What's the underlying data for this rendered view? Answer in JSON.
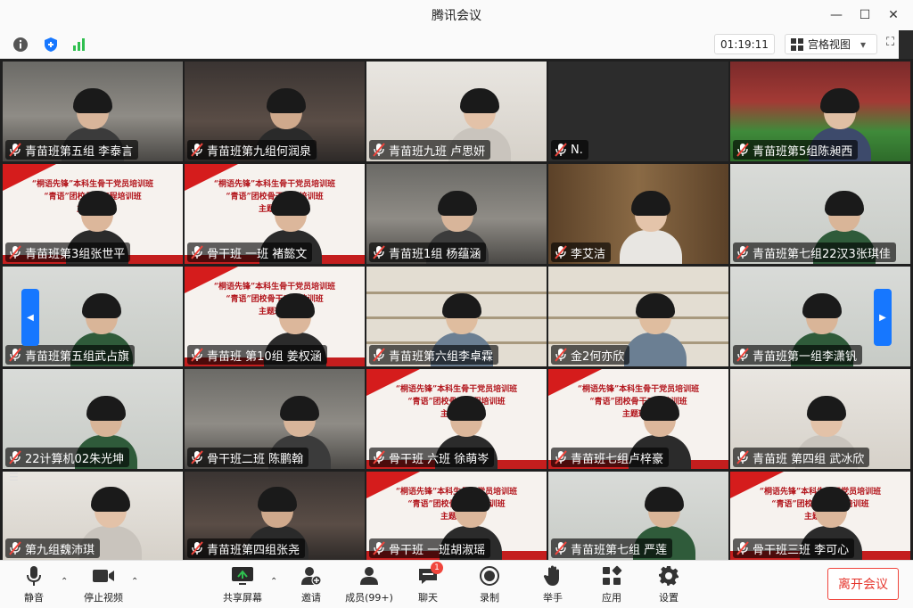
{
  "window": {
    "title": "腾讯会议",
    "minimize": "—",
    "maximize": "☐",
    "close": "✕"
  },
  "topbar": {
    "info_icon": "info-icon",
    "security_icon": "shield-icon",
    "signal_icon": "signal-icon",
    "timer": "01:19:11",
    "view_mode": "宫格视图",
    "view_mode_caret": "▾",
    "fullscreen_icon": "⛶"
  },
  "participants": [
    {
      "name": "青苗班第五组 李泰言",
      "scene": "room"
    },
    {
      "name": "青苗班第九组何润泉",
      "scene": "dark"
    },
    {
      "name": "青苗班九班 卢思妍",
      "scene": "bright"
    },
    {
      "name": "N.",
      "scene": "empty"
    },
    {
      "name": "青苗班第5组陈昶西",
      "scene": "stadium"
    },
    {
      "name": "青苗班第3组张世平",
      "scene": "banner"
    },
    {
      "name": "骨干班 一班 褚懿文",
      "scene": "banner"
    },
    {
      "name": "青苗班1组 杨蕴涵",
      "scene": "room"
    },
    {
      "name": "李艾洁",
      "scene": "books"
    },
    {
      "name": "青苗班第七组22汉3张琪佳",
      "scene": "light"
    },
    {
      "name": "青苗班第五组武占旗",
      "scene": "light"
    },
    {
      "name": "青苗班 第10组 姜权涵",
      "scene": "banner"
    },
    {
      "name": "青苗班第六组李卓霖",
      "scene": "shelf"
    },
    {
      "name": "金2何亦欣",
      "scene": "shelf"
    },
    {
      "name": "青苗班第一组李潇钒",
      "scene": "light"
    },
    {
      "name": "22计算机02朱光坤",
      "scene": "light"
    },
    {
      "name": "骨干班二班 陈鹏翰",
      "scene": "room"
    },
    {
      "name": "骨干班 六班 徐萌岑",
      "scene": "banner"
    },
    {
      "name": "青苗班七组卢梓豪",
      "scene": "banner"
    },
    {
      "name": "青苗班 第四组 武冰欣",
      "scene": "bright"
    },
    {
      "name": "第九组魏沛琪",
      "scene": "bright"
    },
    {
      "name": "青苗班第四组张尧",
      "scene": "dark"
    },
    {
      "name": "骨干班 一班胡淑瑶",
      "scene": "banner"
    },
    {
      "name": "青苗班第七组 严莲",
      "scene": "light"
    },
    {
      "name": "骨干班三班 李可心",
      "scene": "banner"
    }
  ],
  "banner_text": {
    "line1": "“桐语先锋”本科生骨干党员培训班",
    "line2": "“青语”团校骨干工程培训班",
    "line3": "主题班会"
  },
  "controls": {
    "mute": "静音",
    "stop_video": "停止视频",
    "share_screen": "共享屏幕",
    "invite": "邀请",
    "members": "成员(99+)",
    "chat": "聊天",
    "chat_badge": "1",
    "record": "录制",
    "raise_hand": "举手",
    "apps": "应用",
    "settings": "设置",
    "leave": "离开会议",
    "caret": "⌃"
  },
  "colors": {
    "accent": "#1677ff",
    "leave": "#e5352c",
    "signal": "#2fbf4f",
    "badge": "#f0453c"
  }
}
